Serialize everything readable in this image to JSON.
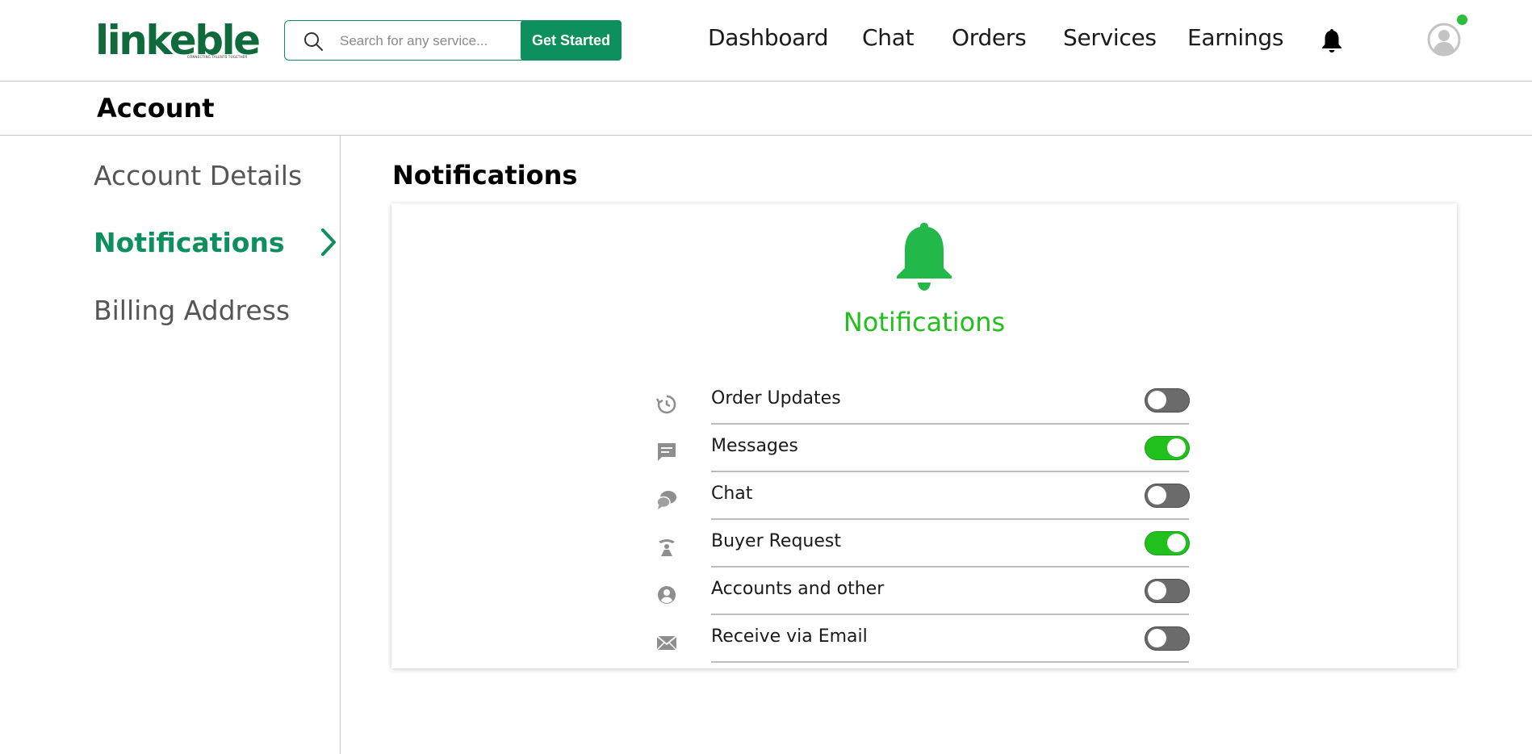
{
  "brand": {
    "logo_text": "linkeble",
    "tagline": "CONNECTING TALENTS TOGETHER",
    "color": "#0f6b3c"
  },
  "search": {
    "placeholder": "Search for any service...",
    "value": "",
    "button_label": "Get Started"
  },
  "nav": {
    "items": [
      "Dashboard",
      "Chat",
      "Orders",
      "Services",
      "Earnings"
    ],
    "icons": [
      "bell-icon",
      "avatar-icon"
    ],
    "online": true
  },
  "page": {
    "section_title": "Account",
    "main_title": "Notifications"
  },
  "sidebar": {
    "items": [
      {
        "label": "Account Details",
        "active": false
      },
      {
        "label": "Notifications",
        "active": true
      },
      {
        "label": "Billing Address",
        "active": false
      }
    ]
  },
  "card": {
    "title": "Notifications",
    "rows": [
      {
        "label": "Order Updates",
        "icon": "clock-refresh-icon",
        "enabled": false
      },
      {
        "label": "Messages",
        "icon": "message-icon",
        "enabled": true
      },
      {
        "label": "Chat",
        "icon": "chat-bubbles-icon",
        "enabled": false
      },
      {
        "label": "Buyer Request",
        "icon": "buyer-request-icon",
        "enabled": true
      },
      {
        "label": "Accounts and other",
        "icon": "account-circle-icon",
        "enabled": false
      },
      {
        "label": "Receive via Email",
        "icon": "envelope-icon",
        "enabled": false
      }
    ]
  },
  "colors": {
    "accent": "#0e8f5e",
    "toggle_on": "#22c01c",
    "toggle_off": "#6b6b6b",
    "bell": "#22b84a",
    "online_dot": "#2ebd3a"
  }
}
